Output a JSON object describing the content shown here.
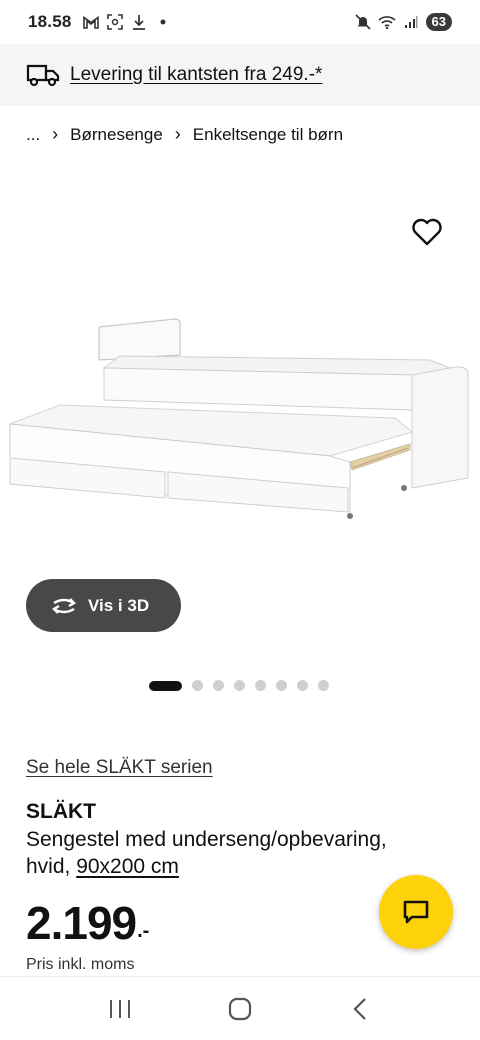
{
  "status_bar": {
    "time": "18.58",
    "battery": "63",
    "icons": [
      "gmail-icon",
      "screenshot-icon",
      "download-icon",
      "dot-icon",
      "mute-icon",
      "wifi-icon",
      "signal-icon"
    ]
  },
  "delivery_banner": {
    "text": "Levering til kantsten fra 249.-*",
    "icon": "truck-icon"
  },
  "breadcrumb": {
    "items": [
      "...",
      "Børnesenge",
      "Enkeltsenge til børn"
    ]
  },
  "product": {
    "view_3d_label": "Vis i 3D",
    "image_count": 8,
    "active_image_index": 0,
    "series_link": "Se hele SLÄKT serien",
    "name": "SLÄKT",
    "description_prefix": "Sengestel med underseng/opbevaring, hvid, ",
    "size_link": "90x200 cm",
    "price_integer": "2.199",
    "price_decimal": ".-",
    "price_note": "Pris inkl. moms"
  },
  "colors": {
    "accent_yellow": "#fdd20a",
    "banner_bg": "#f5f5f5",
    "pill_bg": "#484848"
  },
  "nav": {
    "icons": [
      "recent-apps-icon",
      "home-icon",
      "back-icon"
    ]
  }
}
